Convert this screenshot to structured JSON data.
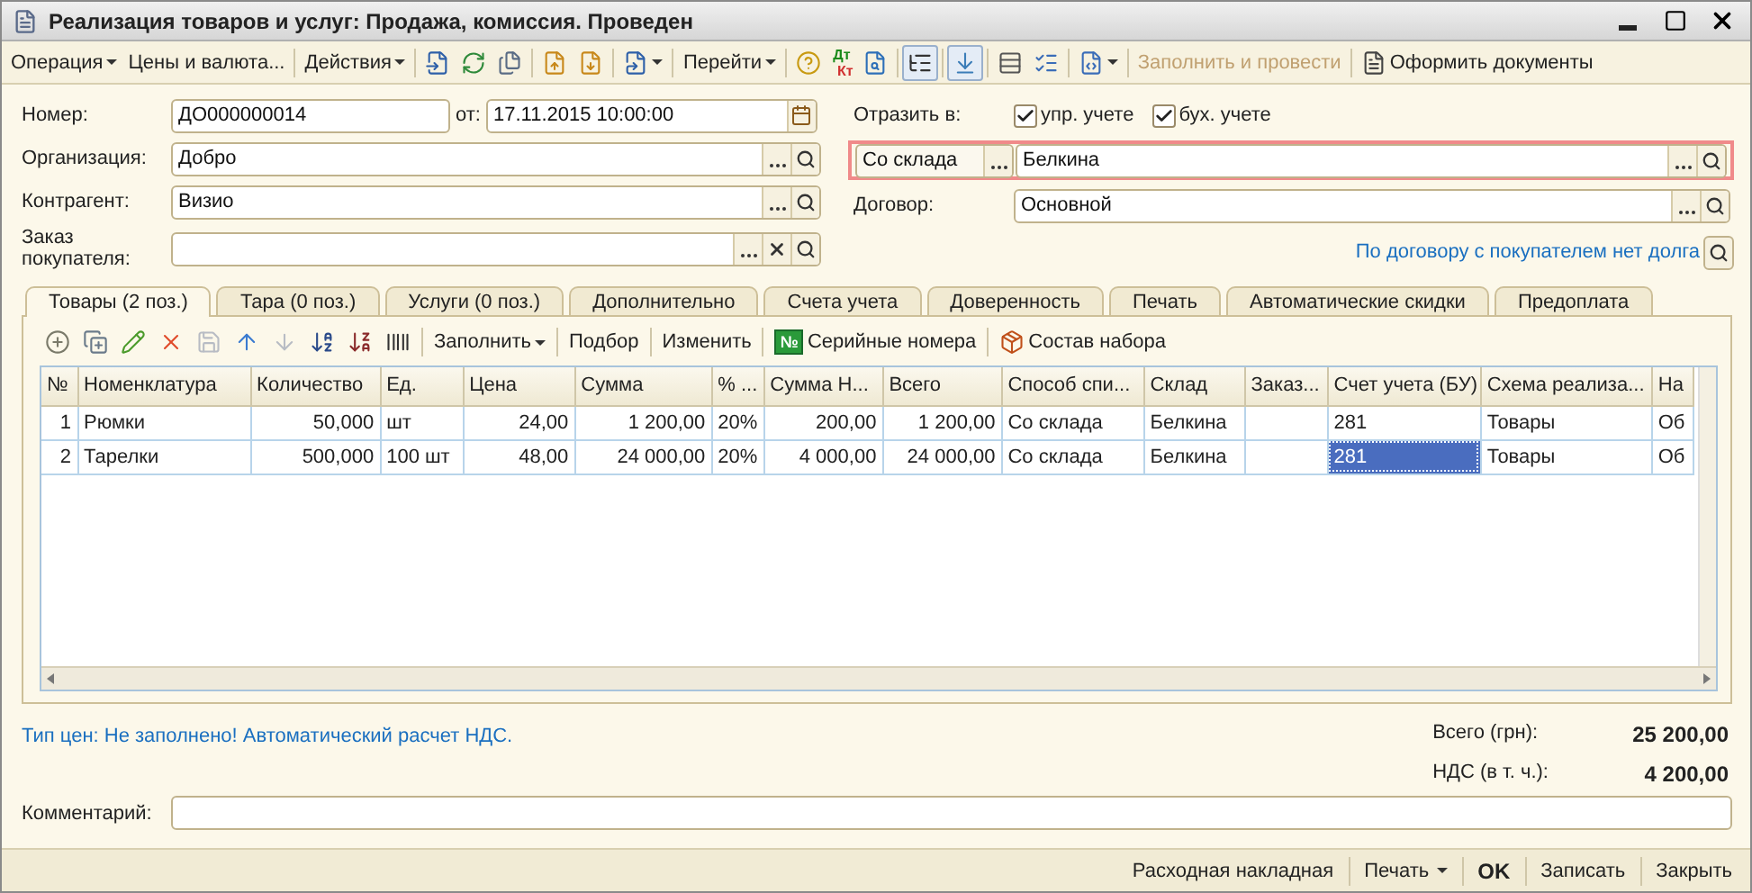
{
  "window": {
    "title": "Реализация товаров и услуг: Продажа, комиссия. Проведен"
  },
  "toolbar": [
    {
      "kind": "menu",
      "label": "Операция"
    },
    {
      "kind": "text",
      "label": "Цены и валюта..."
    },
    {
      "kind": "sep"
    },
    {
      "kind": "menu",
      "label": "Действия"
    },
    {
      "kind": "sep"
    },
    {
      "kind": "icon"
    },
    {
      "kind": "icon"
    },
    {
      "kind": "icon"
    },
    {
      "kind": "sep"
    },
    {
      "kind": "icon"
    },
    {
      "kind": "icon"
    },
    {
      "kind": "sep"
    },
    {
      "kind": "iconmenu"
    },
    {
      "kind": "sep"
    },
    {
      "kind": "menu",
      "label": "Перейти"
    },
    {
      "kind": "sep"
    },
    {
      "kind": "icon"
    },
    {
      "kind": "dtkt",
      "top": "Дт",
      "bottom": "Кт"
    },
    {
      "kind": "icon"
    },
    {
      "kind": "sep"
    },
    {
      "kind": "icon",
      "pressed": true
    },
    {
      "kind": "sep"
    },
    {
      "kind": "icon",
      "pressed": true
    },
    {
      "kind": "sep"
    },
    {
      "kind": "icon"
    },
    {
      "kind": "icon"
    },
    {
      "kind": "sep"
    },
    {
      "kind": "iconmenu"
    },
    {
      "kind": "sep"
    },
    {
      "kind": "text",
      "label": "Заполнить и провести",
      "disabled": true
    },
    {
      "kind": "sep"
    },
    {
      "kind": "icontext",
      "label": "Оформить документы"
    }
  ],
  "form": {
    "number": {
      "label": "Номер:",
      "value": "ДО000000014"
    },
    "date": {
      "label": "от:",
      "value": "17.11.2015 10:00:00"
    },
    "organization": {
      "label": "Организация:",
      "value": "Добро"
    },
    "counterparty": {
      "label": "Контрагент:",
      "value": "Визио"
    },
    "customer_order": {
      "label": "Заказ покупателя:"
    },
    "reflect": {
      "label": "Отразить в:",
      "options": [
        {
          "label": "упр. учете",
          "checked": true
        },
        {
          "label": "бух. учете",
          "checked": true
        }
      ]
    },
    "warehouse": {
      "highlighted": true,
      "mode": "Со склада",
      "value": "Белкина"
    },
    "contract": {
      "label": "Договор:",
      "value": "Основной"
    },
    "debt_link": "По договору с покупателем нет долга"
  },
  "tabs": [
    {
      "label": "Товары (2 поз.)",
      "selected": true
    },
    {
      "label": "Тара (0 поз.)",
      "selected": false
    },
    {
      "label": "Услуги (0 поз.)",
      "selected": false
    },
    {
      "label": "Дополнительно",
      "selected": false
    },
    {
      "label": "Счета учета",
      "selected": false
    },
    {
      "label": "Доверенность",
      "selected": false
    },
    {
      "label": "Печать",
      "selected": false
    },
    {
      "label": "Автоматические скидки",
      "selected": false
    },
    {
      "label": "Предоплата",
      "selected": false
    }
  ],
  "table_toolbar": [
    {
      "kind": "icon"
    },
    {
      "kind": "icon"
    },
    {
      "kind": "icon"
    },
    {
      "kind": "icon"
    },
    {
      "kind": "icon",
      "disabled": true
    },
    {
      "kind": "icon"
    },
    {
      "kind": "icon",
      "disabled": true
    },
    {
      "kind": "icon"
    },
    {
      "kind": "icon"
    },
    {
      "kind": "icon"
    },
    {
      "kind": "sep"
    },
    {
      "kind": "menu",
      "label": "Заполнить"
    },
    {
      "kind": "sep"
    },
    {
      "kind": "text",
      "label": "Подбор"
    },
    {
      "kind": "sep"
    },
    {
      "kind": "text",
      "label": "Изменить"
    },
    {
      "kind": "sep"
    },
    {
      "kind": "badgetext",
      "badge": "№",
      "label": "Серийные номера"
    },
    {
      "kind": "sep"
    },
    {
      "kind": "icontext",
      "label": "Состав набора"
    }
  ],
  "table": {
    "columns": [
      "№",
      "Номенклатура",
      "Количество",
      "Ед.",
      "Цена",
      "Сумма",
      "% ...",
      "Сумма Н...",
      "Всего",
      "Способ спи...",
      "Склад",
      "Заказ...",
      "Счет учета (БУ)",
      "Схема реализа...",
      "На"
    ],
    "rows": [
      {
        "cells": [
          {
            "text": "1",
            "selected": false
          },
          {
            "text": "Рюмки",
            "selected": false
          },
          {
            "text": "50,000",
            "selected": false
          },
          {
            "text": "шт",
            "selected": false
          },
          {
            "text": "24,00",
            "selected": false
          },
          {
            "text": "1 200,00",
            "selected": false
          },
          {
            "text": "20%",
            "selected": false
          },
          {
            "text": "200,00",
            "selected": false
          },
          {
            "text": "1 200,00",
            "selected": false
          },
          {
            "text": "Со склада",
            "selected": false
          },
          {
            "text": "Белкина",
            "selected": false
          },
          {
            "selected": false
          },
          {
            "text": "281",
            "selected": false
          },
          {
            "text": "Товары",
            "selected": false
          },
          {
            "text": "Об",
            "selected": false
          }
        ]
      },
      {
        "cells": [
          {
            "text": "2",
            "selected": false
          },
          {
            "text": "Тарелки",
            "selected": false
          },
          {
            "text": "500,000",
            "selected": false
          },
          {
            "text": "100 шт",
            "selected": false
          },
          {
            "text": "48,00",
            "selected": false
          },
          {
            "text": "24 000,00",
            "selected": false
          },
          {
            "text": "20%",
            "selected": false
          },
          {
            "text": "4 000,00",
            "selected": false
          },
          {
            "text": "24 000,00",
            "selected": false
          },
          {
            "text": "Со склада",
            "selected": false
          },
          {
            "text": "Белкина",
            "selected": false
          },
          {
            "selected": false
          },
          {
            "text": "281",
            "selected": true
          },
          {
            "text": "Товары",
            "selected": false
          },
          {
            "text": "Об",
            "selected": false
          }
        ]
      }
    ]
  },
  "price_type_link": "Тип цен: Не заполнено! Автоматический расчет НДС.",
  "totals": [
    {
      "label": "Всего (грн):",
      "value": "25 200,00"
    },
    {
      "label": "НДС (в т. ч.):",
      "value": "4 200,00"
    }
  ],
  "comment": {
    "label": "Комментарий:"
  },
  "footer_buttons": [
    {
      "kind": "button",
      "label": "Расходная накладная"
    },
    {
      "kind": "menu",
      "label": "Печать"
    },
    {
      "kind": "default",
      "label": "OK"
    },
    {
      "kind": "button",
      "label": "Записать"
    },
    {
      "kind": "button",
      "label": "Закрыть"
    }
  ]
}
